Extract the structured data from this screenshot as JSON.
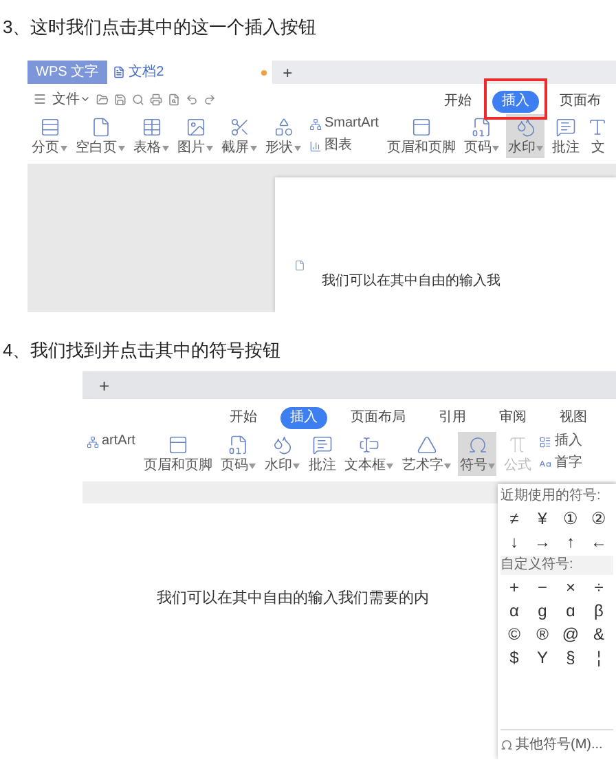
{
  "steps": [
    {
      "heading": "3、这时我们点击其中的这一个插入按钮",
      "screenshot": {
        "tab_bar": {
          "app_tab": "WPS 文字",
          "doc_tab": "文档2",
          "new_tab": "+"
        },
        "file_menu": "文件",
        "ribbon_tabs": [
          {
            "label": "开始",
            "selected": false,
            "highlighted": false
          },
          {
            "label": "插入",
            "selected": true,
            "highlighted": true
          },
          {
            "label": "页面布",
            "selected": false,
            "highlighted": false
          }
        ],
        "tools": [
          {
            "label": "分页",
            "kind": "large",
            "dropdown": true,
            "selected": false,
            "disabled": false
          },
          {
            "label": "空白页",
            "kind": "large",
            "dropdown": true,
            "selected": false,
            "disabled": false
          },
          {
            "label": "表格",
            "kind": "large",
            "dropdown": true,
            "selected": false,
            "disabled": false
          },
          {
            "label": "图片",
            "kind": "large",
            "dropdown": true,
            "selected": false,
            "disabled": false
          },
          {
            "label": "截屏",
            "kind": "large",
            "dropdown": true,
            "selected": false,
            "disabled": false
          },
          {
            "label": "形状",
            "kind": "large",
            "dropdown": true,
            "selected": false,
            "disabled": false
          },
          {
            "label": "SmartArt",
            "kind": "small",
            "dropdown": false,
            "selected": false,
            "disabled": false
          },
          {
            "label": "图表",
            "kind": "small",
            "dropdown": false,
            "selected": false,
            "disabled": false
          },
          {
            "label": "页眉和页脚",
            "kind": "large",
            "dropdown": false,
            "selected": false,
            "disabled": false
          },
          {
            "label": "页码",
            "kind": "large",
            "dropdown": true,
            "selected": false,
            "disabled": false
          },
          {
            "label": "水印",
            "kind": "large",
            "dropdown": true,
            "selected": true,
            "disabled": false
          },
          {
            "label": "批注",
            "kind": "large",
            "dropdown": false,
            "selected": false,
            "disabled": false
          },
          {
            "label": "文",
            "kind": "large",
            "dropdown": false,
            "selected": false,
            "disabled": false
          }
        ],
        "document_text": "我们可以在其中自由的输入我"
      }
    },
    {
      "heading": "4、我们找到并点击其中的符号按钮",
      "screenshot": {
        "tab_bar": {
          "new_tab": "+"
        },
        "ribbon_tabs": [
          {
            "label": "开始",
            "selected": false,
            "highlighted": false
          },
          {
            "label": "插入",
            "selected": true,
            "highlighted": false
          },
          {
            "label": "页面布局",
            "selected": false,
            "highlighted": false
          },
          {
            "label": "引用",
            "selected": false,
            "highlighted": false
          },
          {
            "label": "审阅",
            "selected": false,
            "highlighted": false
          },
          {
            "label": "视图",
            "selected": false,
            "highlighted": false
          }
        ],
        "tools": [
          {
            "label": "artArt",
            "kind": "small",
            "dropdown": false,
            "selected": false,
            "disabled": false
          },
          {
            "label": "页眉和页脚",
            "kind": "large",
            "dropdown": false,
            "selected": false,
            "disabled": false
          },
          {
            "label": "页码",
            "kind": "large",
            "dropdown": true,
            "selected": false,
            "disabled": false
          },
          {
            "label": "水印",
            "kind": "large",
            "dropdown": true,
            "selected": false,
            "disabled": false
          },
          {
            "label": "批注",
            "kind": "large",
            "dropdown": false,
            "selected": false,
            "disabled": false
          },
          {
            "label": "文本框",
            "kind": "large",
            "dropdown": true,
            "selected": false,
            "disabled": false
          },
          {
            "label": "艺术字",
            "kind": "large",
            "dropdown": true,
            "selected": false,
            "disabled": false
          },
          {
            "label": "符号",
            "kind": "large",
            "dropdown": true,
            "selected": true,
            "disabled": false
          },
          {
            "label": "公式",
            "kind": "large",
            "dropdown": false,
            "selected": false,
            "disabled": true
          },
          {
            "label": "插入",
            "kind": "small",
            "dropdown": false,
            "selected": false,
            "disabled": false
          },
          {
            "label": "首字",
            "kind": "small",
            "dropdown": false,
            "selected": false,
            "disabled": false
          }
        ],
        "document_text": "我们可以在其中自由的输入我们需要的内",
        "symbol_panel": {
          "recent_title": "近期使用的符号:",
          "recent": [
            "≠",
            "¥",
            "①",
            "②",
            "↓",
            "→",
            "↑",
            "←"
          ],
          "custom_title": "自定义符号:",
          "custom": [
            "+",
            "−",
            "×",
            "÷",
            "α",
            "g",
            "ɑ",
            "β",
            "©",
            "®",
            "@",
            "&",
            "$",
            "Y",
            "§",
            "¦"
          ],
          "more": "其他符号(M)..."
        }
      }
    }
  ]
}
